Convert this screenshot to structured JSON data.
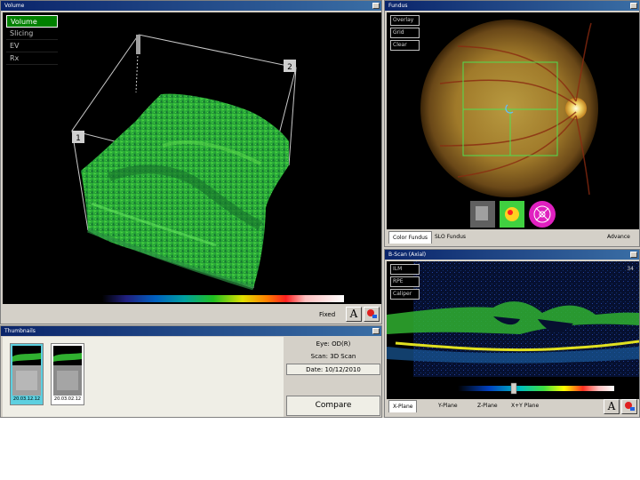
{
  "volume": {
    "title": "Volume",
    "menu": [
      "Volume",
      "Slicing",
      "EV",
      "Rx"
    ],
    "corner_labels": [
      "1",
      "2"
    ],
    "toolbar": {
      "text": "Fixed",
      "font_icon": "A",
      "paint_icon": "paint-icon"
    }
  },
  "fundus": {
    "title": "Fundus",
    "buttons": [
      "Overlay",
      "Grid",
      "Clear"
    ],
    "tabs": [
      "Color Fundus",
      "SLO Fundus",
      "Advance"
    ]
  },
  "bscan": {
    "title": "B-Scan (Axial)",
    "buttons": [
      "ILM",
      "RPE",
      "Caliper"
    ],
    "slice_number": "34",
    "tabs": [
      "X-Plane",
      "Y-Plane",
      "Z-Plane",
      "X+Y Plane"
    ],
    "font_icon": "A",
    "paint_icon": "paint-icon"
  },
  "thumbnails": {
    "title": "Thumbnails",
    "items": [
      {
        "label": "20.03.12.12",
        "selected": true
      },
      {
        "label": "20.03.02.12",
        "selected": false
      }
    ],
    "info": {
      "eye": "Eye: OD(R)",
      "scan": "Scan: 3D Scan",
      "date": "Date: 10/12/2010"
    },
    "compare_label": "Compare"
  },
  "colors": {
    "titlebar": "#0a246a",
    "retina_green": "#3cc83c",
    "selected_thumb": "#5dd0e0"
  }
}
